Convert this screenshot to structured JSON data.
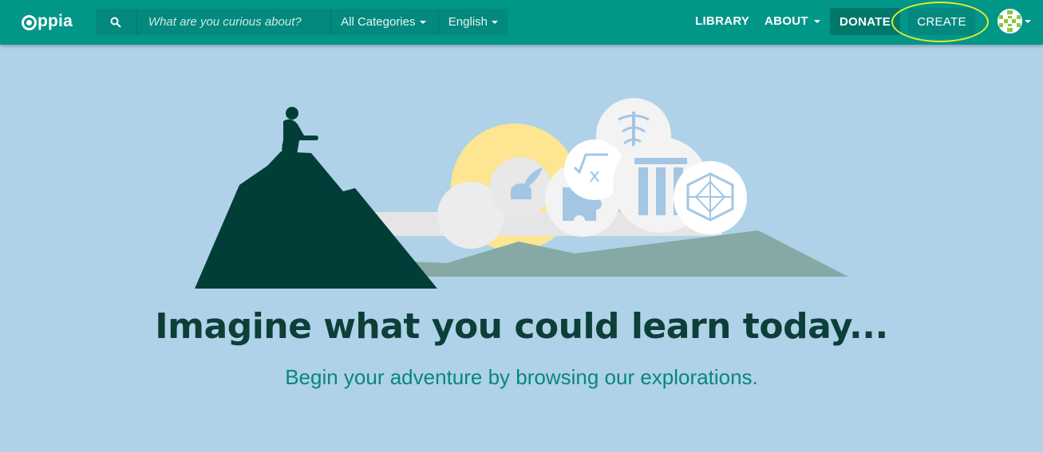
{
  "navbar": {
    "logo_text": "ppia",
    "search": {
      "placeholder": "What are you curious about?",
      "category_selected": "All Categories",
      "language_selected": "English"
    },
    "library_label": "LIBRARY",
    "about_label": "ABOUT",
    "donate_label": "DONATE",
    "create_label": "CREATE"
  },
  "hero": {
    "headline": "Imagine what you could learn today...",
    "subheadline": "Begin your adventure by browsing our explorations."
  },
  "colors": {
    "navbar": "#009688",
    "background": "#afd2e9",
    "headline": "#0b3f38",
    "subheadline": "#08877b",
    "highlight": "#e2ec2a"
  },
  "icons": [
    "search-icon",
    "caret-down-icon",
    "user-avatar-icon",
    "quill-ink-icon",
    "puzzle-piece-icon",
    "square-root-icon",
    "caduceus-icon",
    "column-icon",
    "geometry-icon"
  ]
}
